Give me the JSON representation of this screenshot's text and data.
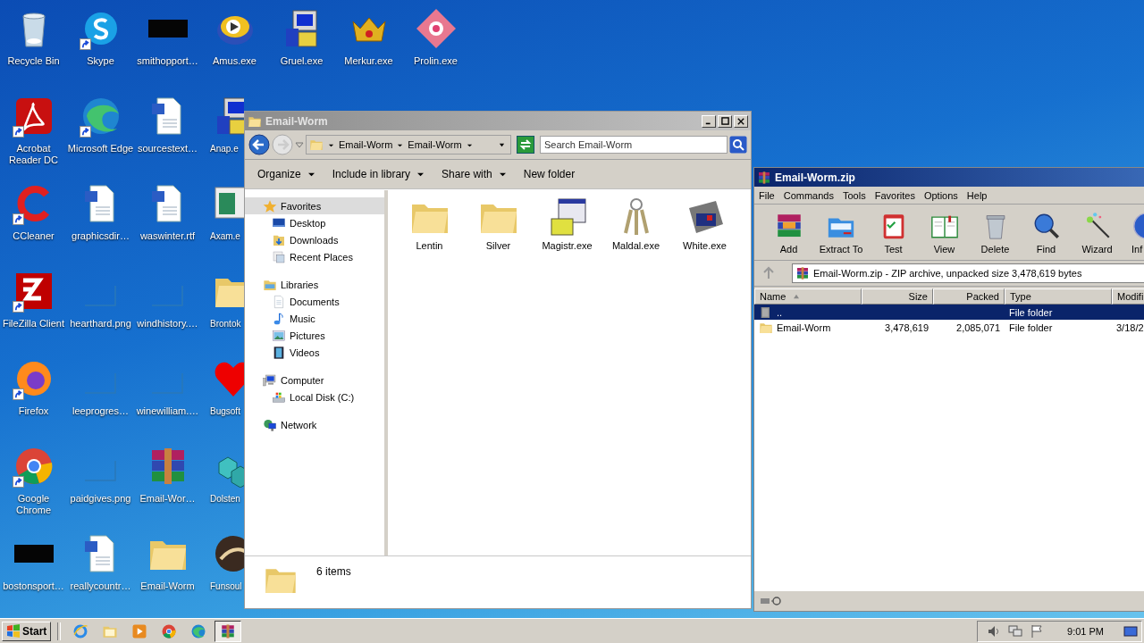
{
  "desktop": {
    "rows": [
      [
        {
          "label": "Recycle Bin",
          "kind": "recycle",
          "shortcut": false
        },
        {
          "label": "Skype",
          "kind": "skype",
          "shortcut": true
        },
        {
          "label": "smithopport…",
          "kind": "black",
          "shortcut": false
        },
        {
          "label": "Amus.exe",
          "kind": "disc",
          "shortcut": false
        },
        {
          "label": "Gruel.exe",
          "kind": "pc",
          "shortcut": false
        },
        {
          "label": "Merkur.exe",
          "kind": "crown",
          "shortcut": false
        },
        {
          "label": "Prolin.exe",
          "kind": "diamond",
          "shortcut": false
        }
      ],
      [
        {
          "label": "Acrobat Reader DC",
          "kind": "acrobat",
          "shortcut": true
        },
        {
          "label": "Microsoft Edge",
          "kind": "edge",
          "shortcut": true
        },
        {
          "label": "sourcestext…",
          "kind": "doc",
          "shortcut": false
        },
        {
          "label": "Anap.e",
          "kind": "pc",
          "shortcut": false
        }
      ],
      [
        {
          "label": "CCleaner",
          "kind": "ccleaner",
          "shortcut": true
        },
        {
          "label": "graphicsdir…",
          "kind": "doc",
          "shortcut": false
        },
        {
          "label": "waswinter.rtf",
          "kind": "doc",
          "shortcut": false
        },
        {
          "label": "Axam.e",
          "kind": "window",
          "shortcut": false
        }
      ],
      [
        {
          "label": "FileZilla Client",
          "kind": "filezilla",
          "shortcut": true
        },
        {
          "label": "hearthard.png",
          "kind": "blank",
          "shortcut": false
        },
        {
          "label": "windhistory.…",
          "kind": "blank",
          "shortcut": false
        },
        {
          "label": "Brontok",
          "kind": "folder",
          "shortcut": false
        }
      ],
      [
        {
          "label": "Firefox",
          "kind": "firefox",
          "shortcut": true
        },
        {
          "label": "leeprogres…",
          "kind": "blank",
          "shortcut": false
        },
        {
          "label": "winewilliam.…",
          "kind": "blank",
          "shortcut": false
        },
        {
          "label": "Bugsoft",
          "kind": "heart",
          "shortcut": false
        }
      ],
      [
        {
          "label": "Google Chrome",
          "kind": "chrome",
          "shortcut": true
        },
        {
          "label": "paidgives.png",
          "kind": "blank",
          "shortcut": false
        },
        {
          "label": "Email-Wor…",
          "kind": "rar",
          "shortcut": false
        },
        {
          "label": "Dolsten",
          "kind": "cubes",
          "shortcut": false
        }
      ],
      [
        {
          "label": "bostonsport…",
          "kind": "black",
          "shortcut": false
        },
        {
          "label": "reallycountr…",
          "kind": "doc",
          "shortcut": false
        },
        {
          "label": "Email-Worm",
          "kind": "folder",
          "shortcut": false
        },
        {
          "label": "Funsoul",
          "kind": "emblem",
          "shortcut": false
        }
      ]
    ]
  },
  "explorer": {
    "title": "Email-Worm",
    "breadcrumb": [
      "Email-Worm",
      "Email-Worm"
    ],
    "search": {
      "placeholder": "Search Email-Worm"
    },
    "toolbar": [
      {
        "label": "Organize",
        "dropdown": true
      },
      {
        "label": "Include in library",
        "dropdown": true
      },
      {
        "label": "Share with",
        "dropdown": true
      },
      {
        "label": "New folder",
        "dropdown": false
      }
    ],
    "tree": [
      {
        "label": "Favorites",
        "kind": "star",
        "selected": true,
        "children": [
          {
            "label": "Desktop",
            "kind": "desktop",
            "selected": false
          },
          {
            "label": "Downloads",
            "kind": "downloads",
            "selected": false
          },
          {
            "label": "Recent Places",
            "kind": "recent",
            "selected": false
          }
        ]
      },
      {
        "label": "Libraries",
        "kind": "libraries",
        "selected": false,
        "children": [
          {
            "label": "Documents",
            "kind": "documents",
            "selected": false
          },
          {
            "label": "Music",
            "kind": "music",
            "selected": false
          },
          {
            "label": "Pictures",
            "kind": "pictures",
            "selected": false
          },
          {
            "label": "Videos",
            "kind": "videos",
            "selected": false
          }
        ]
      },
      {
        "label": "Computer",
        "kind": "computer",
        "selected": false,
        "children": [
          {
            "label": "Local Disk (C:)",
            "kind": "disk",
            "selected": false
          }
        ]
      },
      {
        "label": "Network",
        "kind": "network",
        "selected": false
      }
    ],
    "files": [
      {
        "name": "Lentin",
        "kind": "folder"
      },
      {
        "name": "Silver",
        "kind": "folder"
      },
      {
        "name": "Magistr.exe",
        "kind": "installer"
      },
      {
        "name": "Maldal.exe",
        "kind": "keys"
      },
      {
        "name": "White.exe",
        "kind": "machine"
      }
    ],
    "details": {
      "count": "6 items"
    }
  },
  "winrar": {
    "title": "Email-Worm.zip",
    "menu": [
      "File",
      "Commands",
      "Tools",
      "Favorites",
      "Options",
      "Help"
    ],
    "tools": [
      {
        "label": "Add",
        "kind": "add"
      },
      {
        "label": "Extract To",
        "kind": "extract"
      },
      {
        "label": "Test",
        "kind": "test"
      },
      {
        "label": "View",
        "kind": "view"
      },
      {
        "label": "Delete",
        "kind": "delete"
      },
      {
        "label": "Find",
        "kind": "find"
      },
      {
        "label": "Wizard",
        "kind": "wizard"
      },
      {
        "label": "Inf",
        "kind": "info"
      }
    ],
    "path": "Email-Worm.zip - ZIP archive, unpacked size 3,478,619 bytes",
    "columns": [
      {
        "label": "Name",
        "sorted": true
      },
      {
        "label": "Size"
      },
      {
        "label": "Packed"
      },
      {
        "label": "Type"
      },
      {
        "label": "Modifi"
      }
    ],
    "rows": [
      {
        "name": "..",
        "kind": "up",
        "type": "File folder",
        "selected": true
      },
      {
        "name": "Email-Worm",
        "kind": "folder",
        "size": "3,478,619",
        "packed": "2,085,071",
        "type": "File folder",
        "modified": "3/18/2",
        "selected": false
      }
    ]
  },
  "taskbar": {
    "start": "Start",
    "apps": [
      {
        "kind": "ie",
        "active": false
      },
      {
        "kind": "explorer",
        "active": false
      },
      {
        "kind": "media",
        "active": false
      },
      {
        "kind": "chrome",
        "active": false
      },
      {
        "kind": "edge",
        "active": false
      },
      {
        "kind": "rar",
        "active": true
      }
    ],
    "clock": "9:01 PM"
  }
}
